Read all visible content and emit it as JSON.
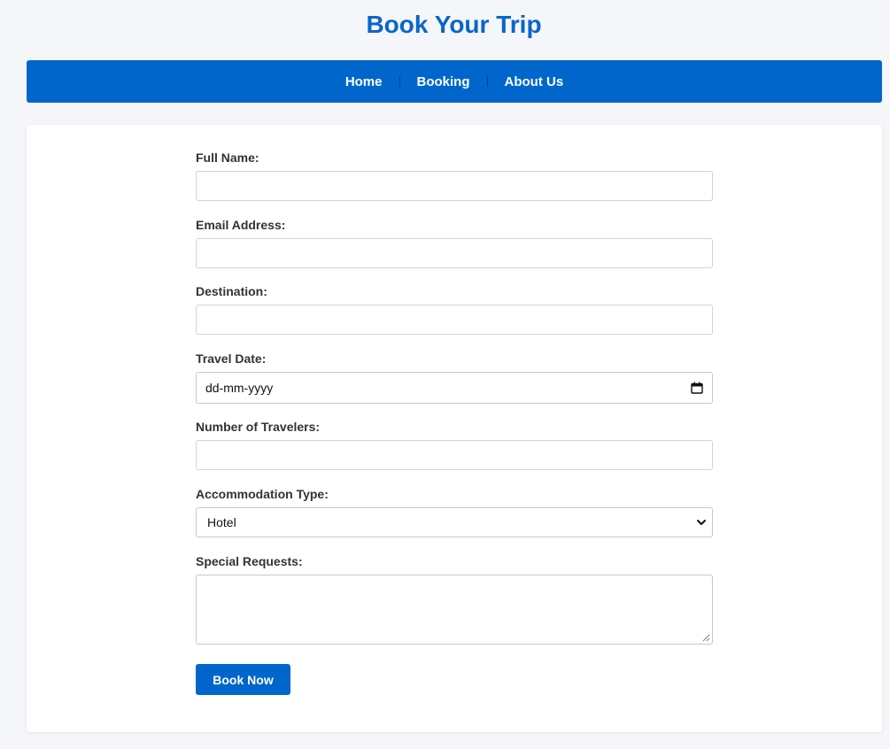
{
  "page": {
    "title": "Book Your Trip"
  },
  "nav": {
    "items": [
      {
        "label": "Home"
      },
      {
        "label": "Booking"
      },
      {
        "label": "About Us"
      }
    ]
  },
  "form": {
    "full_name": {
      "label": "Full Name:",
      "value": ""
    },
    "email": {
      "label": "Email Address:",
      "value": ""
    },
    "destination": {
      "label": "Destination:",
      "value": ""
    },
    "travel_date": {
      "label": "Travel Date:",
      "placeholder": "dd-mm-yyyy",
      "icon": "calendar-icon"
    },
    "travelers": {
      "label": "Number of Travelers:",
      "value": ""
    },
    "accommodation": {
      "label": "Accommodation Type:",
      "selected": "Hotel",
      "icon": "chevron-down-icon"
    },
    "special_requests": {
      "label": "Special Requests:",
      "value": ""
    },
    "submit_label": "Book Now"
  },
  "colors": {
    "accent": "#0066cc",
    "title": "#0a66c8",
    "background": "#f4f6f9",
    "card": "#ffffff"
  }
}
